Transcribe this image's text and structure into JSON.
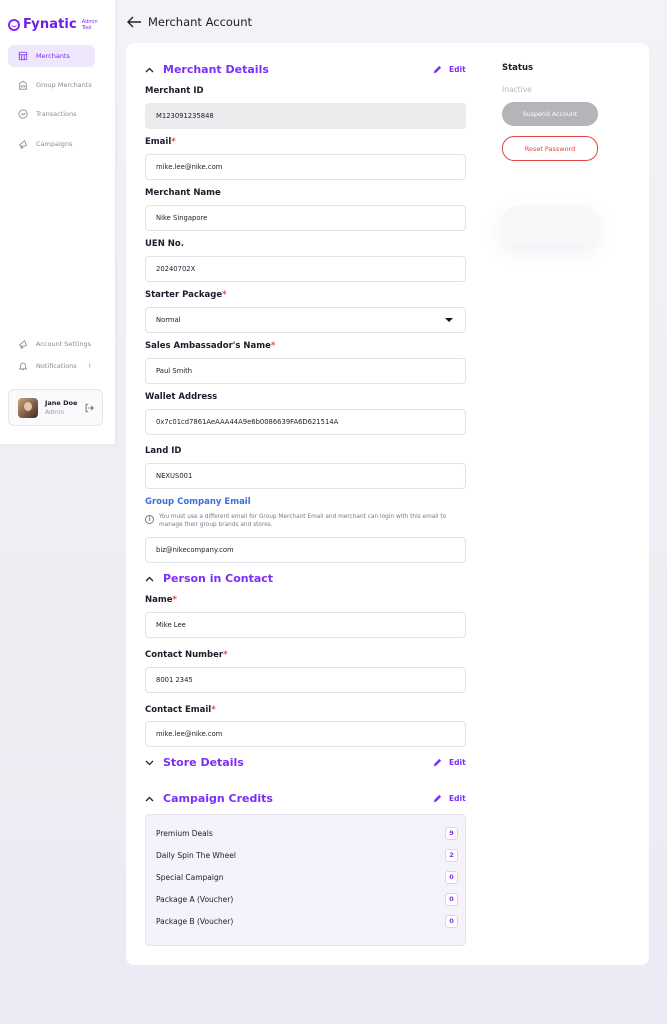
{
  "sidebar": {
    "brand": "Fynatic",
    "brand_sub": "Admin Tool",
    "nav": [
      {
        "label": "Merchants",
        "icon": "store-icon"
      },
      {
        "label": "Group Merchants",
        "icon": "building-icon"
      },
      {
        "label": "Transactions",
        "icon": "transactions-icon"
      },
      {
        "label": "Campaigns",
        "icon": "megaphone-icon"
      }
    ],
    "bottom_nav": [
      {
        "label": "Account Settings",
        "icon": "megaphone-icon"
      },
      {
        "label": "Notifications",
        "icon": "bell-icon",
        "badge": "!"
      }
    ],
    "user": {
      "name": "Jane Doe",
      "role": "Admin"
    }
  },
  "header": {
    "title": "Merchant Account"
  },
  "merchant_details": {
    "title": "Merchant Details",
    "edit": "Edit",
    "fields": {
      "merchant_id": {
        "label": "Merchant ID",
        "value": "M123091235848"
      },
      "email": {
        "label": "Email",
        "value": "mike.lee@nike.com"
      },
      "merchant_name": {
        "label": "Merchant Name",
        "value": "Nike Singapore"
      },
      "uen": {
        "label": "UEN No.",
        "value": "20240702X"
      },
      "starter_package": {
        "label": "Starter Package",
        "value": "Normal"
      },
      "sales_ambassador": {
        "label": "Sales Ambassador's Name",
        "value": "Paul Smith"
      },
      "wallet": {
        "label": "Wallet Address",
        "value": "0x7c01cd7861AeAAA44A9e6b0086639FA6D621514A"
      },
      "land_id": {
        "label": "Land ID",
        "value": "NEXUS001"
      },
      "group_email": {
        "label": "Group Company Email",
        "note": "You must use a different email for Group Merchant Email and merchant can login with this email to manage their group brands and stores.",
        "value": "biz@nikecompany.com"
      }
    },
    "required_mark": "*"
  },
  "person_in_contact": {
    "title": "Person in Contact",
    "fields": {
      "name": {
        "label": "Name",
        "value": "Mike Lee"
      },
      "contact_number": {
        "label": "Contact Number",
        "value": "8001 2345"
      },
      "contact_email": {
        "label": "Contact Email",
        "value": "mike.lee@nike.com"
      }
    }
  },
  "store_details": {
    "title": "Store Details",
    "edit": "Edit"
  },
  "campaign_credits": {
    "title": "Campaign Credits",
    "edit": "Edit",
    "items": [
      {
        "label": "Premium Deals",
        "value": "9"
      },
      {
        "label": "Daily Spin The Wheel",
        "value": "2"
      },
      {
        "label": "Special Campaign",
        "value": "0"
      },
      {
        "label": "Package A (Voucher)",
        "value": "0"
      },
      {
        "label": "Package B (Voucher)",
        "value": "0"
      }
    ]
  },
  "status": {
    "title": "Status",
    "value": "Inactive",
    "suspend": "Suspend Account",
    "reset": "Reset Password"
  },
  "colors": {
    "accent": "#7b2ff7",
    "danger": "#e84545",
    "link_blue": "#3d6fd8"
  }
}
